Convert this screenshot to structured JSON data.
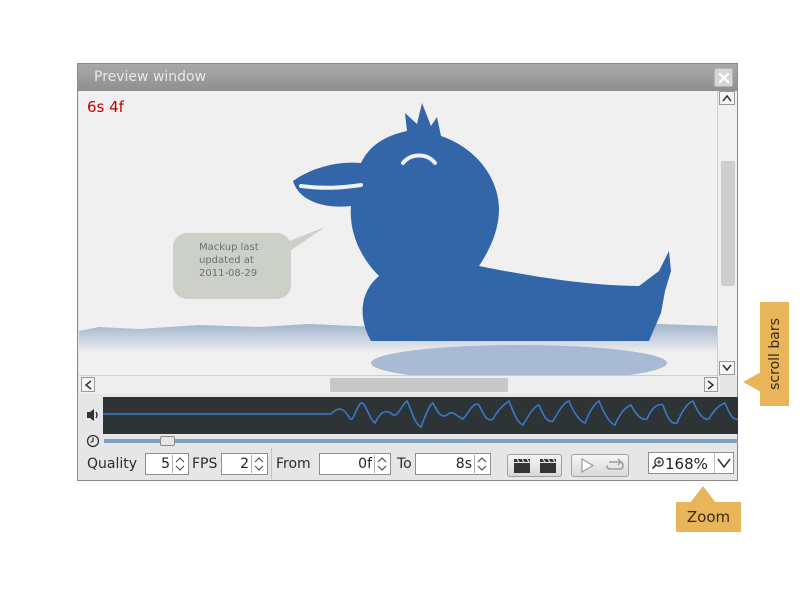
{
  "window": {
    "title": "Preview window"
  },
  "preview": {
    "frame_counter": "6s 4f",
    "speech_lines": [
      "Mackup last",
      "updated at",
      "2011-08-29"
    ]
  },
  "controls": {
    "quality_label": "Quality",
    "quality_value": "5",
    "fps_label": "FPS",
    "fps_value": "2",
    "from_label": "From",
    "from_value": "0f",
    "to_label": "To",
    "to_value": "8s",
    "zoom_value": "168%"
  },
  "timeline": {
    "position_fraction": 0.1
  },
  "callouts": {
    "scroll_bars": "scroll bars",
    "zoom": "Zoom"
  },
  "colors": {
    "duck": "#3366a8",
    "frame_counter": "#c00000",
    "callout": "#e8b55a",
    "waveform_bg": "#2e3436",
    "waveform_line": "#3a78c8"
  }
}
